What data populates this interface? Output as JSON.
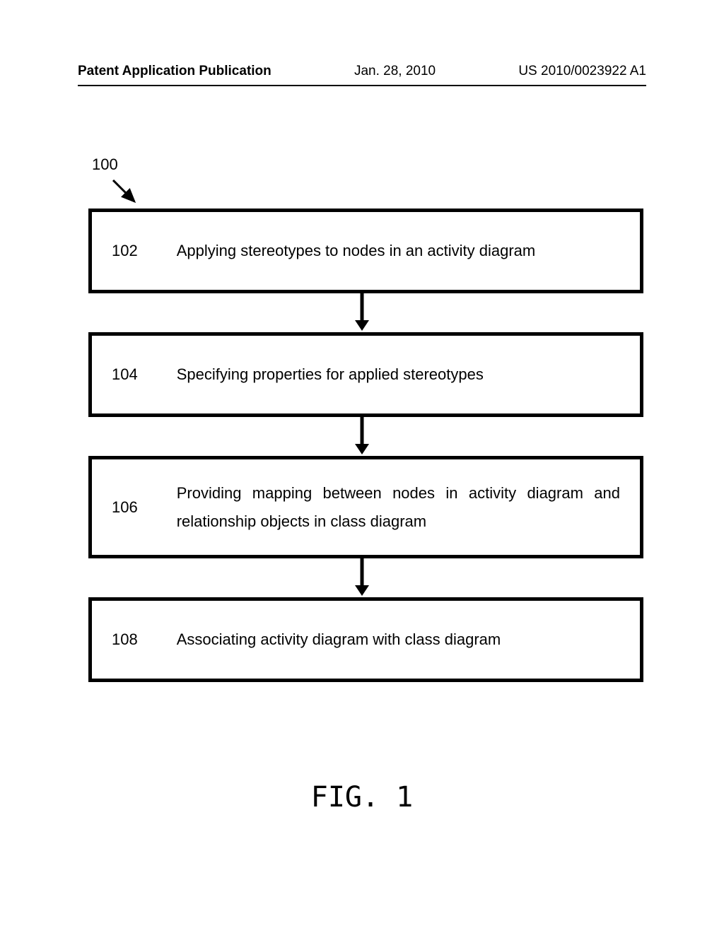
{
  "header": {
    "left": "Patent Application Publication",
    "middle": "Jan. 28, 2010",
    "right": "US 2010/0023922 A1"
  },
  "ref_label": "100",
  "steps": [
    {
      "num": "102",
      "text": "Applying stereotypes to nodes in an activity diagram"
    },
    {
      "num": "104",
      "text": "Specifying properties for applied stereotypes"
    },
    {
      "num": "106",
      "text": "Providing mapping between nodes in activity diagram and relationship objects in class diagram"
    },
    {
      "num": "108",
      "text": "Associating activity diagram with class diagram"
    }
  ],
  "figure_caption": "FIG. 1"
}
